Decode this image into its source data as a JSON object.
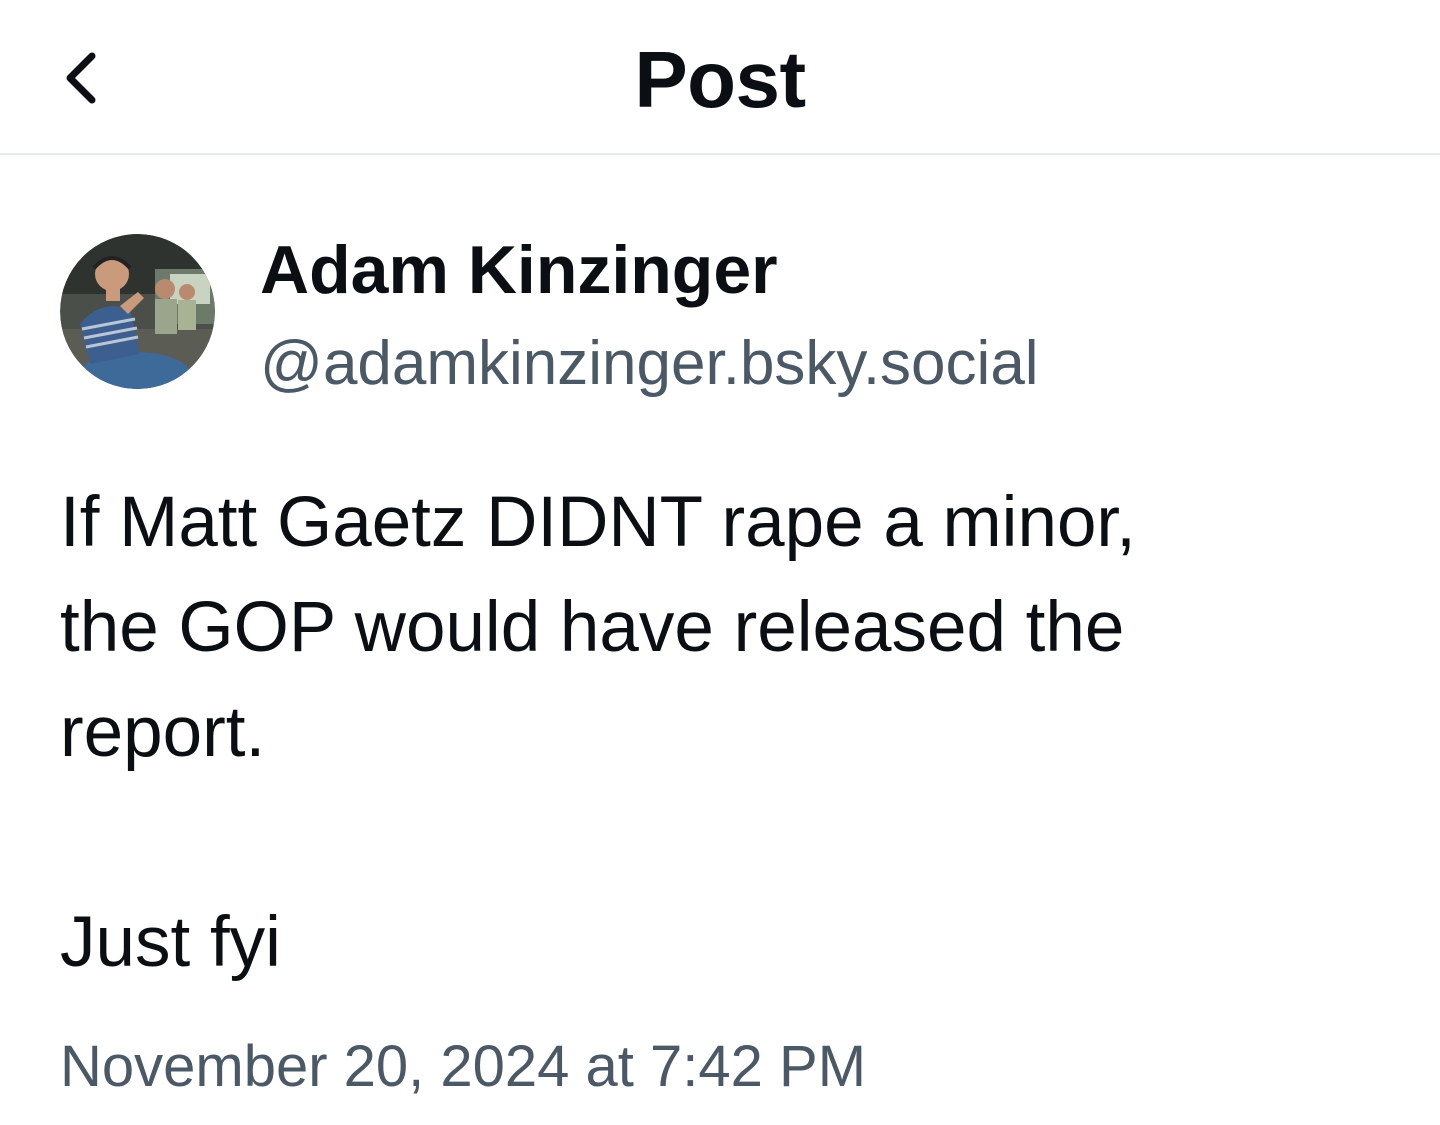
{
  "header": {
    "title": "Post",
    "back_icon": "chevron-left-icon"
  },
  "author": {
    "display_name": "Adam Kinzinger",
    "handle": "@adamkinzinger.bsky.social"
  },
  "post": {
    "text": "If Matt Gaetz DIDNT rape a minor,\nthe GOP would have released the\nreport.\n\nJust fyi",
    "timestamp": "November 20, 2024 at 7:42 PM"
  },
  "colors": {
    "text_primary": "#0b0f14",
    "text_secondary": "#4b5866",
    "divider": "#e6e9ed",
    "background": "#ffffff"
  }
}
